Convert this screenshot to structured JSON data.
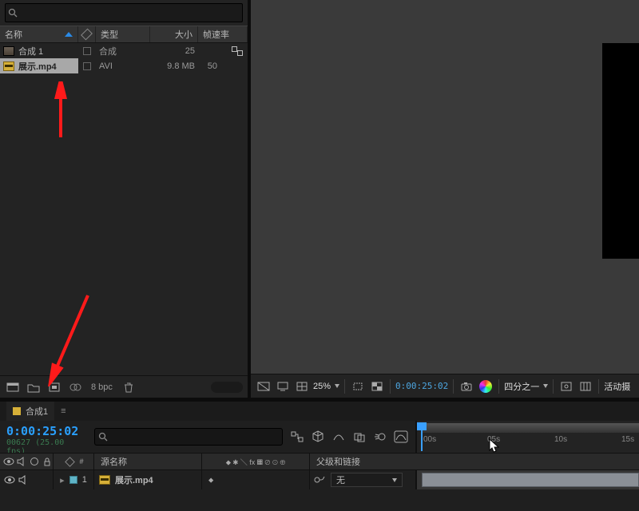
{
  "project": {
    "search_placeholder": "",
    "columns": {
      "name": "名称",
      "type": "类型",
      "size": "大小",
      "fps": "帧速率"
    },
    "rows": [
      {
        "icon": "comp",
        "name": "合成 1",
        "type": "合成",
        "size": "25",
        "fps": "",
        "flow": true
      },
      {
        "icon": "mp4",
        "name": "展示.mp4",
        "type": "AVI",
        "size": "9.8 MB",
        "fps": "50",
        "flow": false,
        "selected": true
      }
    ],
    "bpc": "8 bpc"
  },
  "viewer": {
    "zoom": "25%",
    "timecode": "0:00:25:02",
    "res": "四分之一",
    "right_label": "活动摄"
  },
  "timeline": {
    "tab": "合成1",
    "timecode": "0:00:25:02",
    "subtc": "00627 (25.00 fps)",
    "search_placeholder": "",
    "cols": {
      "src": "源名称",
      "parent": "父级和链接"
    },
    "switch_glyphs": "⬥ ✱ ＼ fx ▦ ⊘ ⊙ ⊕",
    "ruler": [
      "00s",
      "05s",
      "10s",
      "15s"
    ],
    "layer": {
      "num": "1",
      "name": "展示.mp4",
      "parent": "无",
      "glyph": "⬥"
    }
  }
}
